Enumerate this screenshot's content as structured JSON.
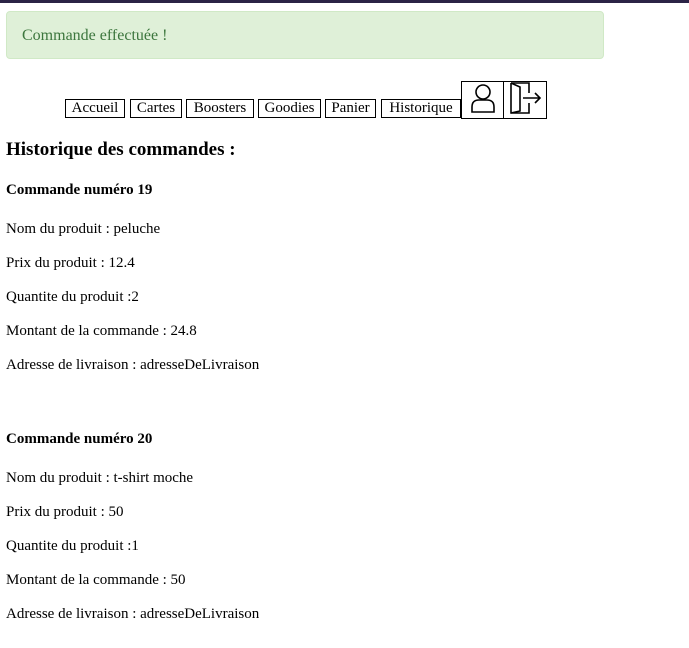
{
  "alert": {
    "message": "Commande effectuée !"
  },
  "nav": {
    "items": [
      "Accueil",
      "Cartes",
      "Boosters",
      "Goodies",
      "Panier",
      "Historique"
    ],
    "icons": [
      "user-icon",
      "logout-icon"
    ]
  },
  "page": {
    "title": "Historique des commandes :"
  },
  "orders": [
    {
      "heading": "Commande numéro 19",
      "product": "Nom du produit : peluche",
      "price": "Prix du produit : 12.4",
      "quantity": "Quantite du produit :2",
      "total": "Montant de la commande : 24.8",
      "address": "Adresse de livraison : adresseDeLivraison"
    },
    {
      "heading": "Commande numéro 20",
      "product": "Nom du produit : t-shirt moche",
      "price": "Prix du produit : 50",
      "quantity": "Quantite du produit :1",
      "total": "Montant de la commande : 50",
      "address": "Adresse de livraison : adresseDeLivraison"
    }
  ]
}
